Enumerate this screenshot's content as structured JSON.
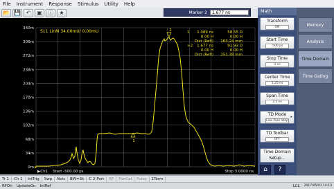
{
  "menu": [
    "File",
    "Instrument",
    "Response",
    "Stimulus",
    "Utility",
    "Help"
  ],
  "toolbar": {
    "icons": [
      "open-icon",
      "save-icon",
      "undo-icon",
      "capture-icon",
      "info-icon",
      "star-icon"
    ],
    "marker_label": "Marker 2",
    "marker_value": "1.677 ns"
  },
  "trace": {
    "title": "S11 LinM 34.00mU/ 0.00mU",
    "y_ticks": [
      "340m",
      "306m",
      "272m",
      "238m",
      "204m",
      "170m",
      "136m",
      "102m",
      "68m",
      "34m",
      "0m"
    ],
    "start_label": "Start  -500.00 ps",
    "stop_label": "Stop  3.0000 ns",
    "ch_label": "▶Ch1",
    "color": "#f2e21a"
  },
  "markers_table": [
    {
      "num": "1",
      "c1": "1.089 ns",
      "c2": "58.55 D"
    },
    {
      "num": "",
      "c1": "0.00 H",
      "c2": "0.00 H"
    },
    {
      "num": "",
      "c1": "Dist (Refl)",
      "c2": "163.24 mm"
    },
    {
      "num": ">2",
      "c1": "1.677 ns",
      "c2": "91.93 D"
    },
    {
      "num": "",
      "c1": "0.00 H",
      "c2": "0.00 H"
    },
    {
      "num": "",
      "c1": "Dist (Refl)",
      "c2": "251.38 mm"
    }
  ],
  "math_panel": {
    "header": "Math",
    "softkeys": [
      {
        "label": "Transform",
        "value": "ON"
      },
      {
        "label": "Start Time",
        "value": "-500 ps"
      },
      {
        "label": "Stop Time",
        "value": "3 ns"
      },
      {
        "label": "Center Time",
        "value": "1.25 ns"
      },
      {
        "label": "Span Time",
        "value": "3.5 ns"
      },
      {
        "label": "TD Mode",
        "value": "Low Pass Step"
      },
      {
        "label": "TD Toolbar",
        "value": "OFF"
      },
      {
        "label": "Time Domain",
        "value": "Setup..."
      }
    ]
  },
  "tabs": [
    "Memory",
    "Analysis",
    "Time Domain",
    "Time Gating"
  ],
  "status_bar_1": [
    "Tr 1",
    "Ch 1",
    "IntTrig",
    "Swp",
    "Nvis",
    "BW=3k",
    "C 2-Port",
    "RF",
    "PwrCal",
    "Pulse",
    "1Term"
  ],
  "status_bar_2": {
    "left": [
      "RFOn",
      "UpdateOn",
      "IntRef"
    ],
    "right": [
      "LCL",
      "2017/05/01 14:13"
    ]
  }
}
